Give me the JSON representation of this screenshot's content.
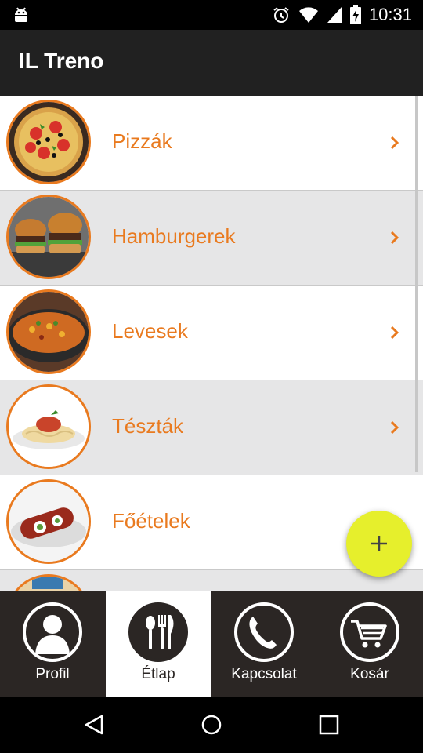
{
  "status_bar": {
    "time": "10:31",
    "icons": [
      "android-icon",
      "alarm-icon",
      "wifi-icon",
      "signal-icon",
      "battery-charging-icon"
    ]
  },
  "app_bar": {
    "title": "IL Treno"
  },
  "menu": {
    "items": [
      {
        "label": "Pizzák",
        "image": "pizza-image",
        "has_arrow": true
      },
      {
        "label": "Hamburgerek",
        "image": "hamburger-image",
        "has_arrow": true
      },
      {
        "label": "Levesek",
        "image": "soup-image",
        "has_arrow": true
      },
      {
        "label": "Tészták",
        "image": "pasta-image",
        "has_arrow": true
      },
      {
        "label": "Főételek",
        "image": "main-dish-image",
        "has_arrow": false
      }
    ]
  },
  "fab": {
    "icon": "plus-icon",
    "color": "#e6ef2c"
  },
  "tabs": [
    {
      "label": "Profil",
      "icon": "person-icon",
      "active": false
    },
    {
      "label": "Étlap",
      "icon": "cutlery-icon",
      "active": true
    },
    {
      "label": "Kapcsolat",
      "icon": "phone-icon",
      "active": false
    },
    {
      "label": "Kosár",
      "icon": "cart-icon",
      "active": false
    }
  ],
  "nav_bar": {
    "icons": [
      "back-icon",
      "home-icon",
      "recents-icon"
    ]
  },
  "colors": {
    "accent": "#e97a1f",
    "tabbar": "#2b2624",
    "app_bar": "#212121"
  }
}
